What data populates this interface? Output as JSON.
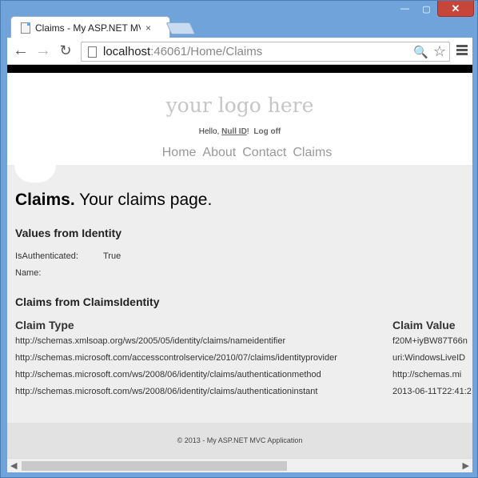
{
  "browser": {
    "tab_title": "Claims - My ASP.NET MVC",
    "tab_close": "×",
    "url_host": "localhost",
    "url_rest": ":46061/Home/Claims",
    "window_buttons": {
      "min": "—",
      "max": "▢",
      "close": "✕"
    },
    "icons": {
      "back": "←",
      "forward": "→",
      "reload": "↻",
      "zoom": "🔍",
      "star": "☆"
    }
  },
  "site": {
    "logo": "your logo here",
    "hello": "Hello, ",
    "user": "Null ID",
    "exclaim": "!",
    "logoff": "Log off",
    "nav": [
      "Home",
      "About",
      "Contact",
      "Claims"
    ]
  },
  "page": {
    "title_bold": "Claims.",
    "title_rest": " Your claims page.",
    "identity_heading": "Values from Identity",
    "is_auth_label": "IsAuthenticated:",
    "is_auth_value": "True",
    "name_label": "Name:",
    "claims_heading": "Claims from ClaimsIdentity",
    "col_type": "Claim Type",
    "col_value": "Claim Value",
    "claims": [
      {
        "type": "http://schemas.xmlsoap.org/ws/2005/05/identity/claims/nameidentifier",
        "value": "f20M+iyBW87T66n"
      },
      {
        "type": "http://schemas.microsoft.com/accesscontrolservice/2010/07/claims/identityprovider",
        "value": "uri:WindowsLiveID"
      },
      {
        "type": "http://schemas.microsoft.com/ws/2008/06/identity/claims/authenticationmethod",
        "value": "http://schemas.mi"
      },
      {
        "type": "http://schemas.microsoft.com/ws/2008/06/identity/claims/authenticationinstant",
        "value": "2013-06-11T22:41:2"
      }
    ],
    "footer": "© 2013 - My ASP.NET MVC Application"
  },
  "scrollbar": {
    "left": "◀",
    "right": "▶"
  }
}
